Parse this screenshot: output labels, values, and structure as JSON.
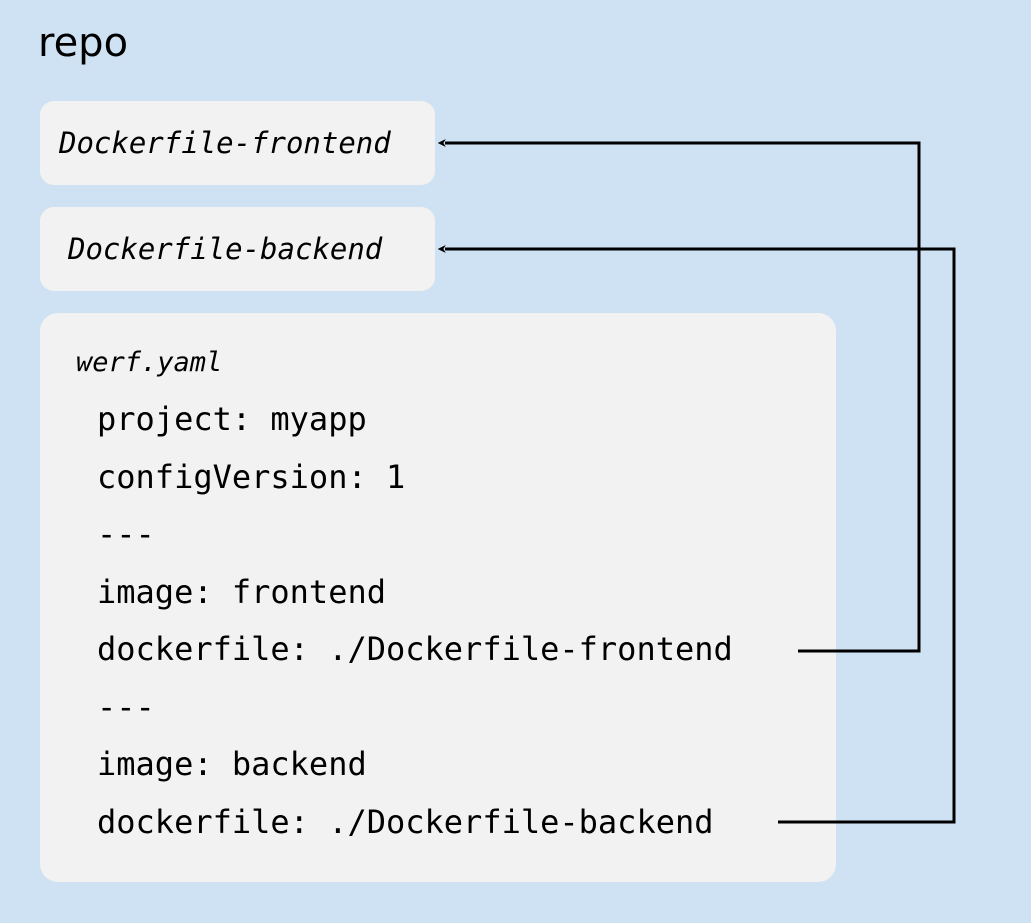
{
  "title": "repo",
  "files": [
    {
      "name": "Dockerfile-frontend"
    },
    {
      "name": "Dockerfile-backend"
    }
  ],
  "config": {
    "filename": "werf.yaml",
    "lines": [
      "project: myapp",
      "configVersion: 1",
      "---",
      "image: frontend",
      "dockerfile: ./Dockerfile-frontend",
      "---",
      "image: backend",
      "dockerfile: ./Dockerfile-backend"
    ]
  },
  "connections": [
    {
      "from": "dockerfile: ./Dockerfile-frontend",
      "to": "Dockerfile-frontend"
    },
    {
      "from": "dockerfile: ./Dockerfile-backend",
      "to": "Dockerfile-backend"
    }
  ],
  "colors": {
    "background": "#cfe2f3",
    "box": "#f2f2f2",
    "line": "#000000"
  }
}
